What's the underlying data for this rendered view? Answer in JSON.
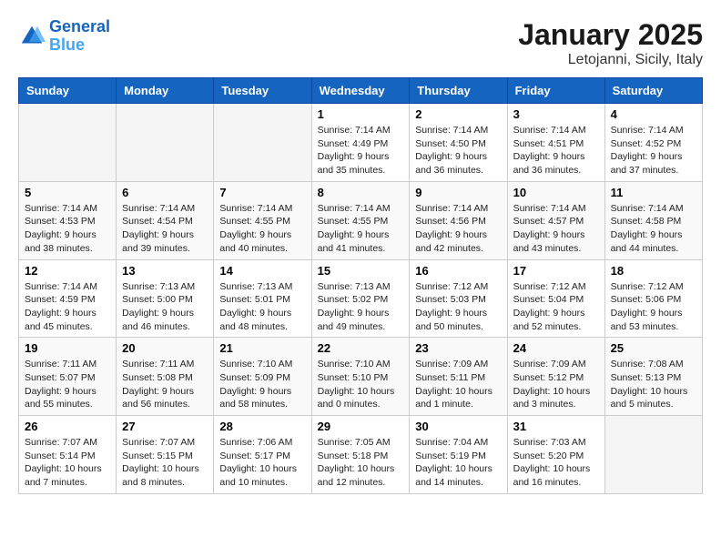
{
  "header": {
    "logo_line1": "General",
    "logo_line2": "Blue",
    "month": "January 2025",
    "location": "Letojanni, Sicily, Italy"
  },
  "weekdays": [
    "Sunday",
    "Monday",
    "Tuesday",
    "Wednesday",
    "Thursday",
    "Friday",
    "Saturday"
  ],
  "weeks": [
    [
      {
        "day": "",
        "info": ""
      },
      {
        "day": "",
        "info": ""
      },
      {
        "day": "",
        "info": ""
      },
      {
        "day": "1",
        "info": "Sunrise: 7:14 AM\nSunset: 4:49 PM\nDaylight: 9 hours\nand 35 minutes."
      },
      {
        "day": "2",
        "info": "Sunrise: 7:14 AM\nSunset: 4:50 PM\nDaylight: 9 hours\nand 36 minutes."
      },
      {
        "day": "3",
        "info": "Sunrise: 7:14 AM\nSunset: 4:51 PM\nDaylight: 9 hours\nand 36 minutes."
      },
      {
        "day": "4",
        "info": "Sunrise: 7:14 AM\nSunset: 4:52 PM\nDaylight: 9 hours\nand 37 minutes."
      }
    ],
    [
      {
        "day": "5",
        "info": "Sunrise: 7:14 AM\nSunset: 4:53 PM\nDaylight: 9 hours\nand 38 minutes."
      },
      {
        "day": "6",
        "info": "Sunrise: 7:14 AM\nSunset: 4:54 PM\nDaylight: 9 hours\nand 39 minutes."
      },
      {
        "day": "7",
        "info": "Sunrise: 7:14 AM\nSunset: 4:55 PM\nDaylight: 9 hours\nand 40 minutes."
      },
      {
        "day": "8",
        "info": "Sunrise: 7:14 AM\nSunset: 4:55 PM\nDaylight: 9 hours\nand 41 minutes."
      },
      {
        "day": "9",
        "info": "Sunrise: 7:14 AM\nSunset: 4:56 PM\nDaylight: 9 hours\nand 42 minutes."
      },
      {
        "day": "10",
        "info": "Sunrise: 7:14 AM\nSunset: 4:57 PM\nDaylight: 9 hours\nand 43 minutes."
      },
      {
        "day": "11",
        "info": "Sunrise: 7:14 AM\nSunset: 4:58 PM\nDaylight: 9 hours\nand 44 minutes."
      }
    ],
    [
      {
        "day": "12",
        "info": "Sunrise: 7:14 AM\nSunset: 4:59 PM\nDaylight: 9 hours\nand 45 minutes."
      },
      {
        "day": "13",
        "info": "Sunrise: 7:13 AM\nSunset: 5:00 PM\nDaylight: 9 hours\nand 46 minutes."
      },
      {
        "day": "14",
        "info": "Sunrise: 7:13 AM\nSunset: 5:01 PM\nDaylight: 9 hours\nand 48 minutes."
      },
      {
        "day": "15",
        "info": "Sunrise: 7:13 AM\nSunset: 5:02 PM\nDaylight: 9 hours\nand 49 minutes."
      },
      {
        "day": "16",
        "info": "Sunrise: 7:12 AM\nSunset: 5:03 PM\nDaylight: 9 hours\nand 50 minutes."
      },
      {
        "day": "17",
        "info": "Sunrise: 7:12 AM\nSunset: 5:04 PM\nDaylight: 9 hours\nand 52 minutes."
      },
      {
        "day": "18",
        "info": "Sunrise: 7:12 AM\nSunset: 5:06 PM\nDaylight: 9 hours\nand 53 minutes."
      }
    ],
    [
      {
        "day": "19",
        "info": "Sunrise: 7:11 AM\nSunset: 5:07 PM\nDaylight: 9 hours\nand 55 minutes."
      },
      {
        "day": "20",
        "info": "Sunrise: 7:11 AM\nSunset: 5:08 PM\nDaylight: 9 hours\nand 56 minutes."
      },
      {
        "day": "21",
        "info": "Sunrise: 7:10 AM\nSunset: 5:09 PM\nDaylight: 9 hours\nand 58 minutes."
      },
      {
        "day": "22",
        "info": "Sunrise: 7:10 AM\nSunset: 5:10 PM\nDaylight: 10 hours\nand 0 minutes."
      },
      {
        "day": "23",
        "info": "Sunrise: 7:09 AM\nSunset: 5:11 PM\nDaylight: 10 hours\nand 1 minute."
      },
      {
        "day": "24",
        "info": "Sunrise: 7:09 AM\nSunset: 5:12 PM\nDaylight: 10 hours\nand 3 minutes."
      },
      {
        "day": "25",
        "info": "Sunrise: 7:08 AM\nSunset: 5:13 PM\nDaylight: 10 hours\nand 5 minutes."
      }
    ],
    [
      {
        "day": "26",
        "info": "Sunrise: 7:07 AM\nSunset: 5:14 PM\nDaylight: 10 hours\nand 7 minutes."
      },
      {
        "day": "27",
        "info": "Sunrise: 7:07 AM\nSunset: 5:15 PM\nDaylight: 10 hours\nand 8 minutes."
      },
      {
        "day": "28",
        "info": "Sunrise: 7:06 AM\nSunset: 5:17 PM\nDaylight: 10 hours\nand 10 minutes."
      },
      {
        "day": "29",
        "info": "Sunrise: 7:05 AM\nSunset: 5:18 PM\nDaylight: 10 hours\nand 12 minutes."
      },
      {
        "day": "30",
        "info": "Sunrise: 7:04 AM\nSunset: 5:19 PM\nDaylight: 10 hours\nand 14 minutes."
      },
      {
        "day": "31",
        "info": "Sunrise: 7:03 AM\nSunset: 5:20 PM\nDaylight: 10 hours\nand 16 minutes."
      },
      {
        "day": "",
        "info": ""
      }
    ]
  ]
}
